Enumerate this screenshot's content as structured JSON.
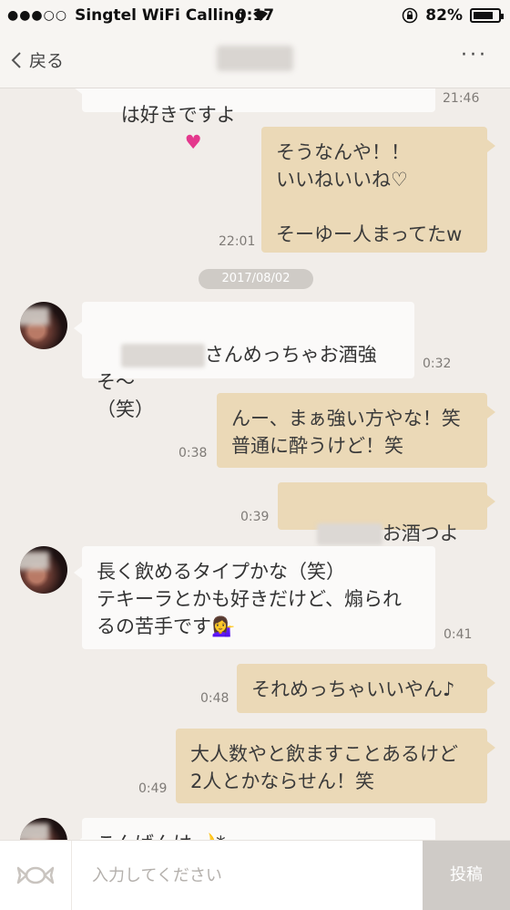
{
  "status_bar": {
    "carrier": "Singtel WiFi Calling",
    "time": "0:17",
    "battery": "82%",
    "battery_level": 0.82
  },
  "nav": {
    "back_label": "戻る",
    "more_label": "···"
  },
  "messages": [
    {
      "side": "in",
      "text": "は好きですよ",
      "time": "21:46"
    },
    {
      "side": "out",
      "text": "そうなんや！！\nいいねいいね♡\n\nそーゆー人まってたw",
      "time": "22:01"
    },
    {
      "side": "date",
      "text": "2017/08/02"
    },
    {
      "side": "in",
      "text": "さんめっちゃお酒強そ〜\n（笑）",
      "time": "0:32"
    },
    {
      "side": "out",
      "text": "んー、まぁ強い方やな！笑\n普通に酔うけど！笑",
      "time": "0:38"
    },
    {
      "side": "out",
      "text": "お酒つよい？",
      "time": "0:39"
    },
    {
      "side": "in",
      "text": "長く飲めるタイプかな（笑）\nテキーラとかも好きだけど、煽られ\nるの苦手です💁‍♀️",
      "time": "0:41"
    },
    {
      "side": "out",
      "text": "それめっちゃいいやん♪",
      "time": "0:48"
    },
    {
      "side": "out",
      "text": "大人数やと飲ますことあるけど\n2人とかならせん！笑",
      "time": "0:49"
    },
    {
      "side": "in",
      "text": "こんばんは🌙*",
      "time": ""
    }
  ],
  "composer": {
    "placeholder": "入力してください",
    "send_label": "投稿"
  },
  "colors": {
    "background": "#f1ede9",
    "incoming_bubble": "#fbfaf9",
    "outgoing_bubble": "#ebd9b7",
    "send_button": "#cfcbc7"
  }
}
